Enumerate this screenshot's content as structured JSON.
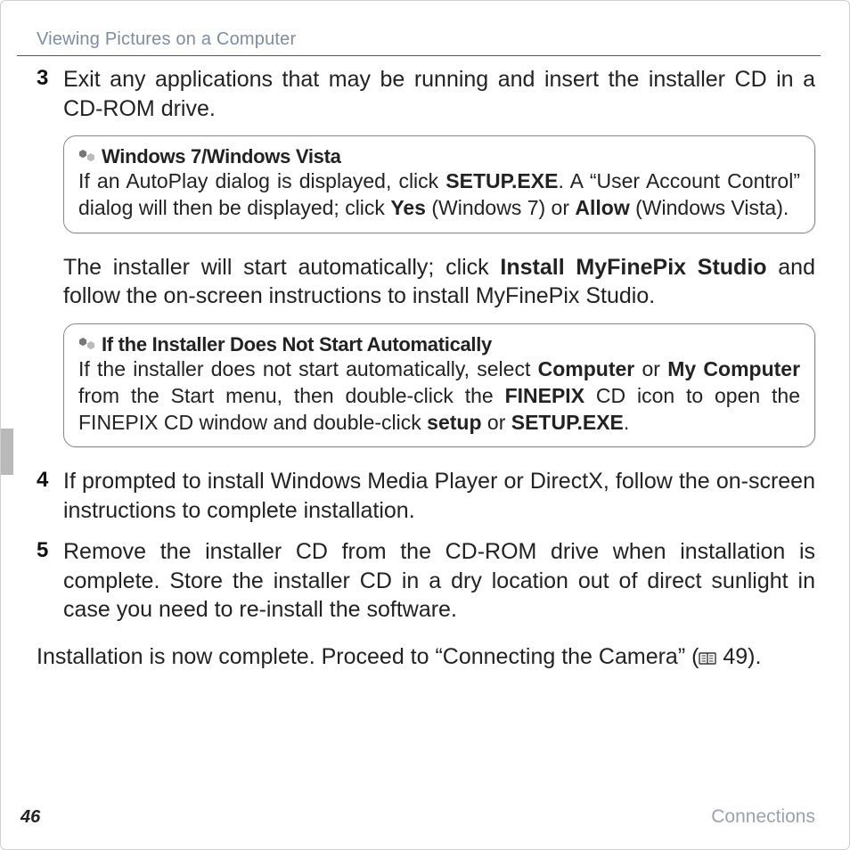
{
  "header": {
    "title": "Viewing Pictures on a Computer"
  },
  "steps": {
    "s3": {
      "num": "3",
      "text_a": "Exit any applications that may be running and insert the installer CD in a CD-ROM drive."
    },
    "s4": {
      "num": "4",
      "text": "If prompted to install Windows Media Player or DirectX, follow the on-screen instructions to complete installation."
    },
    "s5": {
      "num": "5",
      "text": "Remove the installer CD from the CD-ROM drive when installation is complete.  Store the installer CD in a dry location out of direct sunlight in case you need to re-install the software."
    }
  },
  "callout1": {
    "title": "Windows 7/Windows Vista",
    "p1a": "If an AutoPlay dialog is displayed, click ",
    "p1b": "SETUP.EXE",
    "p1c": ".  A “User Account Control” dialog will then be displayed; click ",
    "p1d": "Yes",
    "p1e": " (Windows 7) or ",
    "p1f": "Allow",
    "p1g": " (Windows Vista)."
  },
  "mid_para": {
    "a": "The installer will start automatically; click ",
    "b": "Install MyFinePix Studio",
    "c": " and follow the on-screen instructions to install MyFinePix Studio."
  },
  "callout2": {
    "title": "If the Installer Does Not Start Automatically",
    "a": "If the installer does not start automatically, select ",
    "b": "Computer",
    "c": " or ",
    "d": "My Computer",
    "e": " from the Start menu, then double-click the ",
    "f": "FINEPIX",
    "g": " CD icon to open the FINEPIX CD window and double-click ",
    "h": "setup",
    "i": " or ",
    "j": "SETUP.EXE",
    "k": "."
  },
  "final": {
    "a": "Installation is now complete.  Proceed to “Connecting the Camera” (",
    "b": " 49)."
  },
  "footer": {
    "page": "46",
    "section": "Connections"
  }
}
